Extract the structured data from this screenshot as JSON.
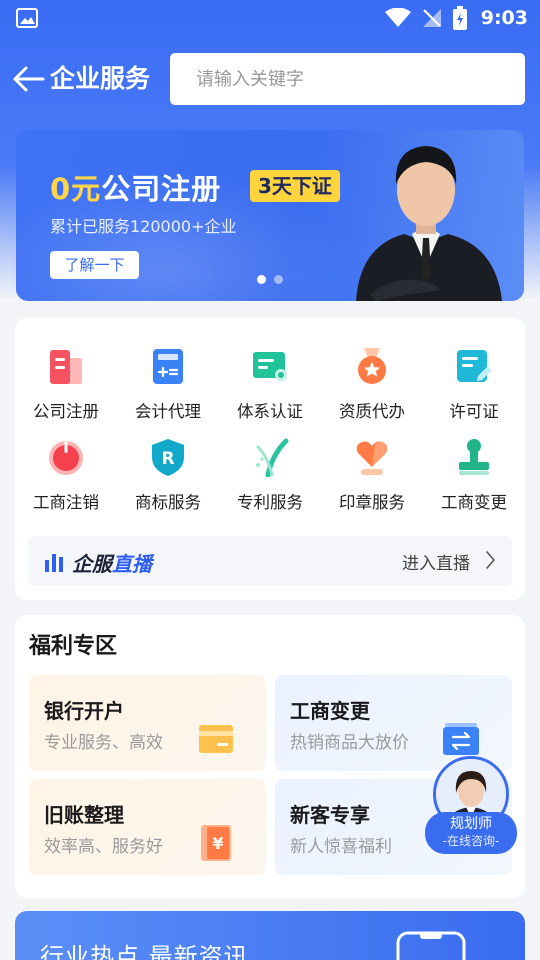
{
  "status_bar": {
    "time": "9:03"
  },
  "header": {
    "title": "企业服务",
    "search_placeholder": "请输入关键字"
  },
  "banner": {
    "title_highlight": "0元",
    "title_rest": "公司注册",
    "badge": "3天下证",
    "subtitle": "累计已服务120000+企业",
    "button": "了解一下",
    "slides": 2,
    "active_slide": 1
  },
  "services": {
    "items": [
      {
        "label": "公司注册",
        "icon": "building-icon"
      },
      {
        "label": "会计代理",
        "icon": "calculator-icon"
      },
      {
        "label": "体系认证",
        "icon": "certificate-icon"
      },
      {
        "label": "资质代办",
        "icon": "medal-icon"
      },
      {
        "label": "许可证",
        "icon": "license-icon"
      },
      {
        "label": "工商注销",
        "icon": "power-icon"
      },
      {
        "label": "商标服务",
        "icon": "trademark-shield-icon"
      },
      {
        "label": "专利服务",
        "icon": "patent-icon"
      },
      {
        "label": "印章服务",
        "icon": "heart-seal-icon"
      },
      {
        "label": "工商变更",
        "icon": "stamp-icon"
      }
    ],
    "live": {
      "title_a": "企服",
      "title_b": "直播",
      "enter": "进入直播"
    }
  },
  "welfare": {
    "title": "福利专区",
    "tiles": [
      {
        "name": "银行开户",
        "desc": "专业服务、高效",
        "icon": "bank-card-icon"
      },
      {
        "name": "工商变更",
        "desc": "热销商品大放价",
        "icon": "exchange-icon"
      },
      {
        "name": "旧账整理",
        "desc": "效率高、服务好",
        "icon": "yen-ledger-icon"
      },
      {
        "name": "新客专享",
        "desc": "新人惊喜福利",
        "icon": "gift-icon"
      }
    ]
  },
  "planner": {
    "name": "规划师",
    "sub": "-在线咨询-"
  },
  "bottom_banner": {
    "title": "行业热点 最新资讯"
  },
  "colors": {
    "primary": "#3a6cf0",
    "badge": "#ffd43d",
    "highlight": "#ffd54a"
  }
}
